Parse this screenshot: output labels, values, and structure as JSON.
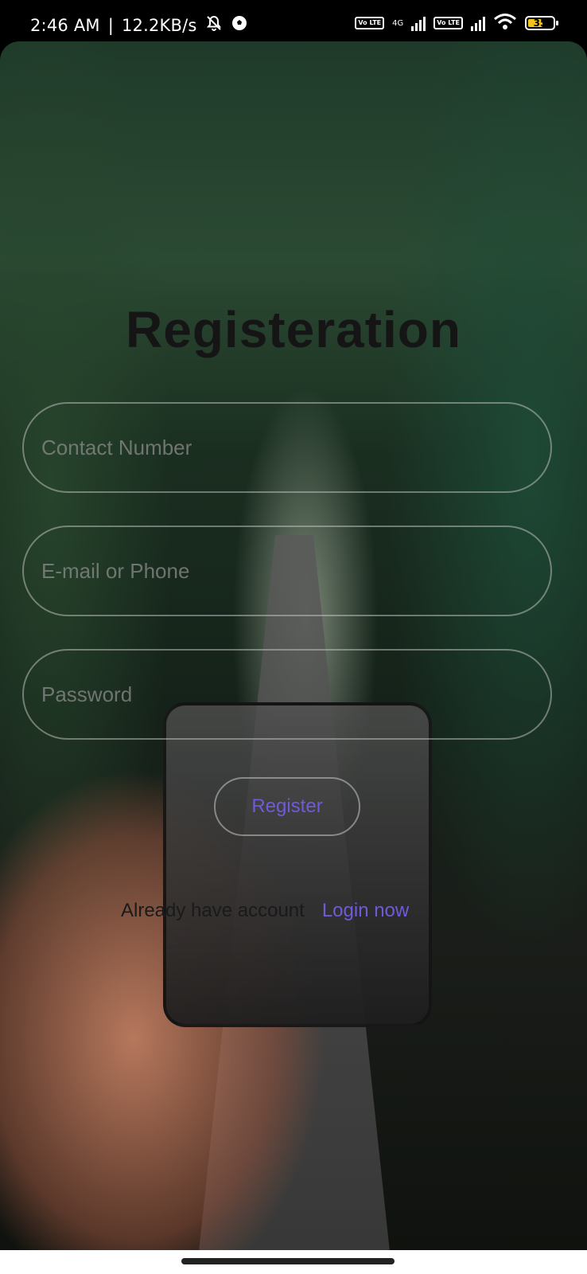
{
  "status_bar": {
    "time": "2:46 AM",
    "network_speed": "12.2KB/s",
    "separator": "|",
    "network_type": "4G",
    "volte_label": "Vo LTE",
    "battery_level": "35",
    "icons": [
      "bell-off-icon",
      "soccer-ball-icon",
      "volte-icon",
      "signal-icon",
      "wifi-icon",
      "battery-icon"
    ]
  },
  "form": {
    "title": "Registeration",
    "contact_placeholder": "Contact Number",
    "email_placeholder": "E-mail or Phone",
    "password_placeholder": "Password",
    "register_label": "Register",
    "login_prompt": "Already have account",
    "login_link": "Login now"
  },
  "colors": {
    "accent": "#6f5bd8",
    "title": "#151515",
    "field_border": "rgba(200,200,200,0.5)"
  }
}
